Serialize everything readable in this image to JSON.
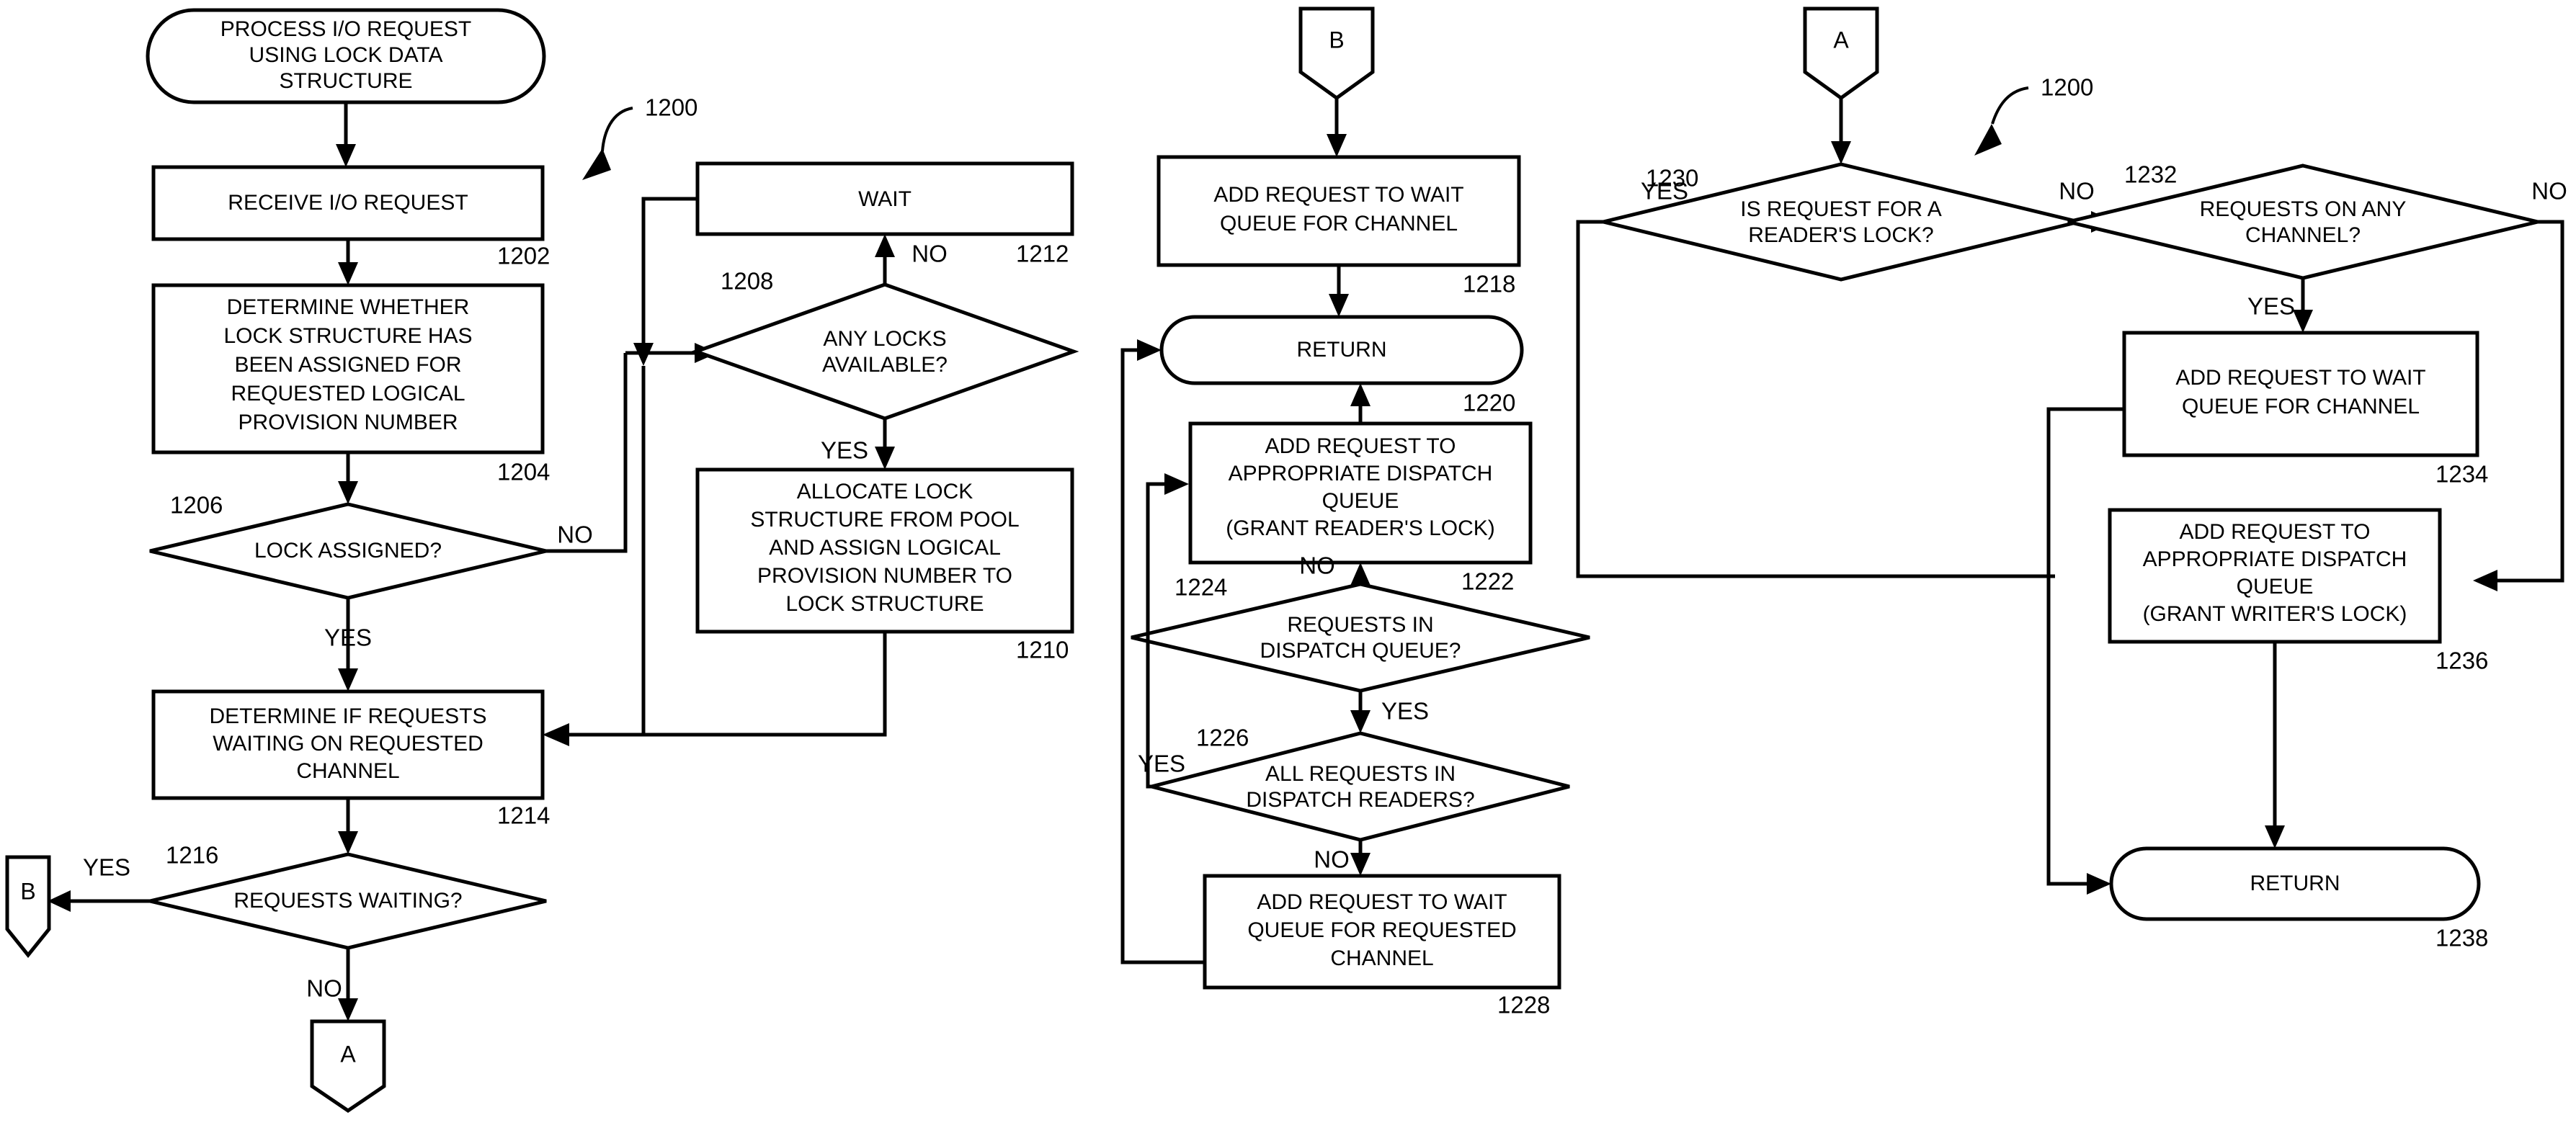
{
  "figure": {
    "reference_numeral": "1200",
    "reference_numeral_right": "1200"
  },
  "nodes": {
    "start": {
      "label_l1": "PROCESS I/O REQUEST",
      "label_l2": "USING LOCK DATA",
      "label_l3": "STRUCTURE",
      "ref": ""
    },
    "n1202": {
      "label_l1": "RECEIVE I/O REQUEST",
      "ref": "1202"
    },
    "n1204": {
      "label_l1": "DETERMINE WHETHER",
      "label_l2": "LOCK STRUCTURE HAS",
      "label_l3": "BEEN ASSIGNED FOR",
      "label_l4": "REQUESTED LOGICAL",
      "label_l5": "PROVISION NUMBER",
      "ref": "1204"
    },
    "n1206": {
      "label_l1": "LOCK ASSIGNED?",
      "ref": "1206",
      "yes": "YES",
      "no": "NO"
    },
    "n1208": {
      "label_l1": "ANY LOCKS",
      "label_l2": "AVAILABLE?",
      "ref": "1208",
      "yes": "YES",
      "no": "NO"
    },
    "n1210": {
      "label_l1": "ALLOCATE LOCK",
      "label_l2": "STRUCTURE FROM POOL",
      "label_l3": "AND ASSIGN LOGICAL",
      "label_l4": "PROVISION NUMBER TO",
      "label_l5": "LOCK STRUCTURE",
      "ref": "1210"
    },
    "n1212": {
      "label_l1": "WAIT",
      "ref": "1212"
    },
    "n1214": {
      "label_l1": "DETERMINE IF REQUESTS",
      "label_l2": "WAITING ON REQUESTED",
      "label_l3": "CHANNEL",
      "ref": "1214"
    },
    "n1216": {
      "label_l1": "REQUESTS WAITING?",
      "ref": "1216",
      "yes": "YES",
      "no": "NO"
    },
    "conn_b_left": {
      "letter": "B"
    },
    "conn_a_left": {
      "letter": "A"
    },
    "conn_b_top": {
      "letter": "B"
    },
    "conn_a_top": {
      "letter": "A"
    },
    "n1218": {
      "label_l1": "ADD REQUEST TO WAIT",
      "label_l2": "QUEUE FOR CHANNEL",
      "ref": "1218"
    },
    "n1220": {
      "label_l1": "RETURN",
      "ref": "1220"
    },
    "n1222": {
      "label_l1": "ADD REQUEST TO",
      "label_l2": "APPROPRIATE DISPATCH",
      "label_l3": "QUEUE",
      "label_l4": "(GRANT READER'S LOCK)",
      "ref": "1222"
    },
    "n1224": {
      "label_l1": "REQUESTS IN",
      "label_l2": "DISPATCH QUEUE?",
      "ref": "1224",
      "yes": "YES",
      "no": "NO"
    },
    "n1226": {
      "label_l1": "ALL REQUESTS IN",
      "label_l2": "DISPATCH READERS?",
      "ref": "1226",
      "yes": "YES",
      "no": "NO"
    },
    "n1228": {
      "label_l1": "ADD REQUEST TO WAIT",
      "label_l2": "QUEUE FOR REQUESTED",
      "label_l3": "CHANNEL",
      "ref": "1228"
    },
    "n1230": {
      "label_l1": "IS REQUEST FOR A",
      "label_l2": "READER'S LOCK?",
      "ref": "1230",
      "yes": "YES",
      "no": "NO"
    },
    "n1232": {
      "label_l1": "REQUESTS ON ANY",
      "label_l2": "CHANNEL?",
      "ref": "1232",
      "yes": "YES",
      "no": "NO"
    },
    "n1234": {
      "label_l1": "ADD REQUEST TO WAIT",
      "label_l2": "QUEUE FOR CHANNEL",
      "ref": "1234"
    },
    "n1236": {
      "label_l1": "ADD REQUEST TO",
      "label_l2": "APPROPRIATE DISPATCH",
      "label_l3": "QUEUE",
      "label_l4": "(GRANT WRITER'S LOCK)",
      "ref": "1236"
    },
    "n1238": {
      "label_l1": "RETURN",
      "ref": "1238"
    }
  },
  "colors": {
    "stroke": "#000000",
    "fill": "#ffffff"
  }
}
